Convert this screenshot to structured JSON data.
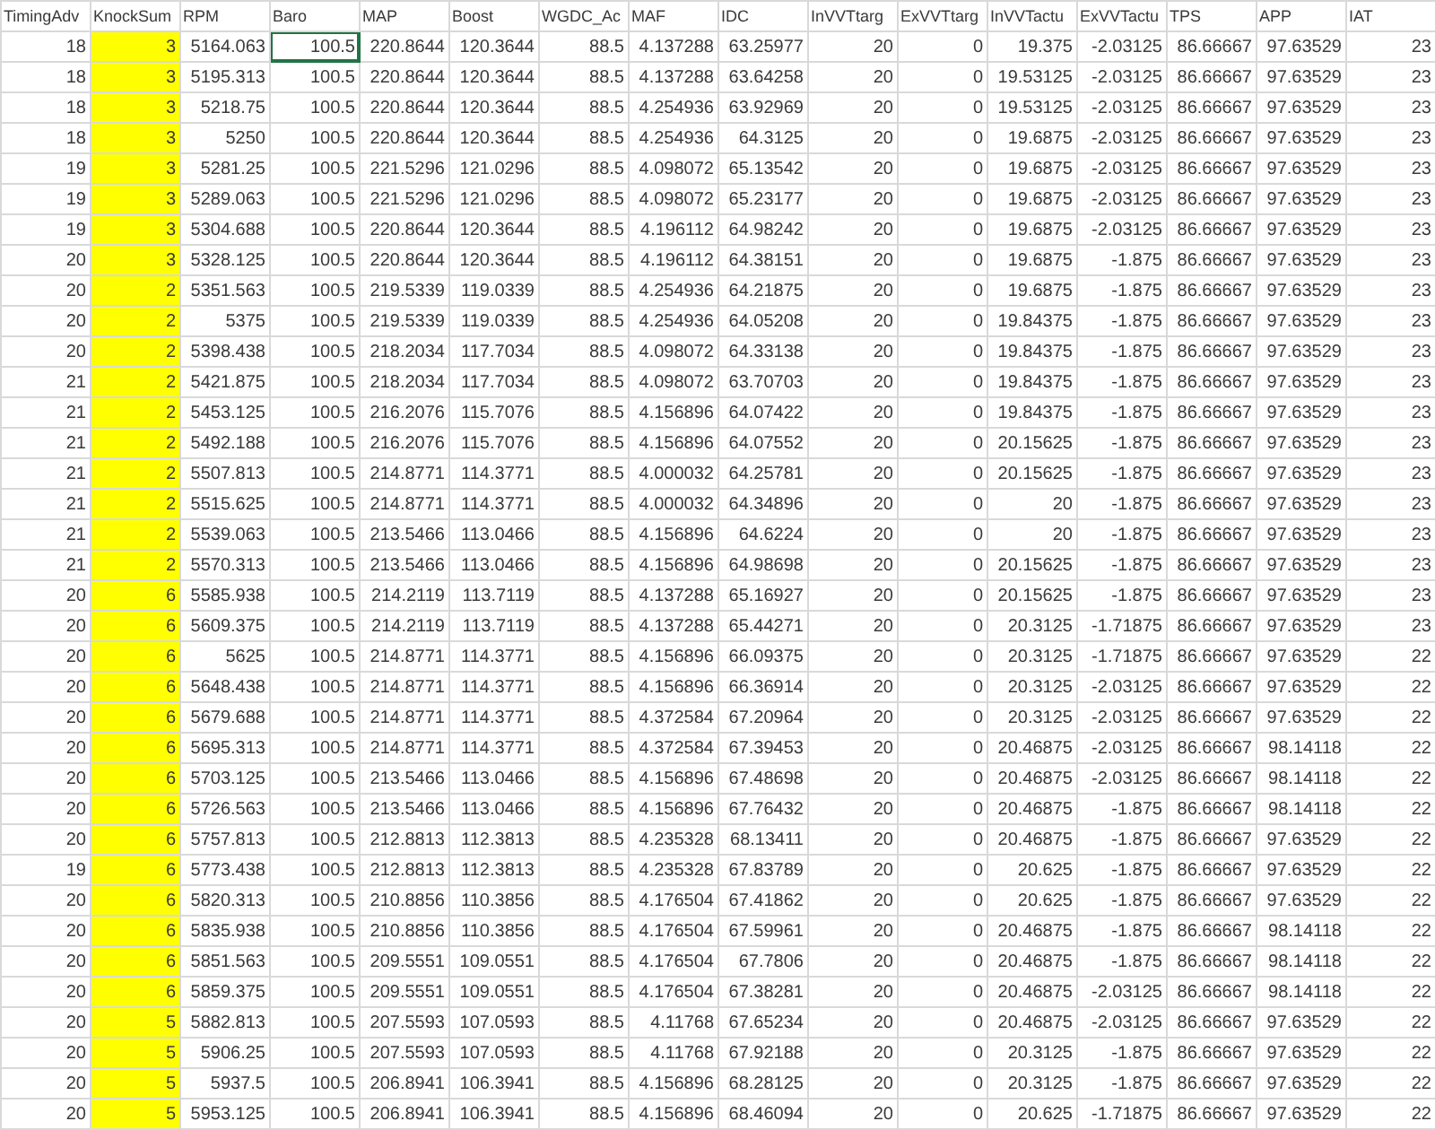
{
  "table": {
    "columns": [
      {
        "label": "TimingAdv",
        "selected": false
      },
      {
        "label": "KnockSum",
        "selected": false,
        "color": "#ffff00"
      },
      {
        "label": "RPM",
        "selected": false
      },
      {
        "label": "Baro",
        "selected": true
      },
      {
        "label": "MAP",
        "selected": false
      },
      {
        "label": "Boost",
        "selected": false
      },
      {
        "label": "WGDC_Ac",
        "selected": false
      },
      {
        "label": "MAF",
        "selected": false
      },
      {
        "label": "IDC",
        "selected": false
      },
      {
        "label": "InVVTtarg",
        "selected": false
      },
      {
        "label": "ExVVTtarg",
        "selected": false
      },
      {
        "label": "InVVTactu",
        "selected": false
      },
      {
        "label": "ExVVTactu",
        "selected": false
      },
      {
        "label": "TPS",
        "selected": false
      },
      {
        "label": "APP",
        "selected": false
      },
      {
        "label": "IAT",
        "selected": false
      }
    ],
    "rows": [
      {
        "selected": true,
        "cells": [
          "18",
          "3",
          "5164.063",
          "100.5",
          "220.8644",
          "120.3644",
          "88.5",
          "4.137288",
          "63.25977",
          "20",
          "0",
          "19.375",
          "-2.03125",
          "86.66667",
          "97.63529",
          "23"
        ]
      },
      {
        "selected": false,
        "cells": [
          "18",
          "3",
          "5195.313",
          "100.5",
          "220.8644",
          "120.3644",
          "88.5",
          "4.137288",
          "63.64258",
          "20",
          "0",
          "19.53125",
          "-2.03125",
          "86.66667",
          "97.63529",
          "23"
        ]
      },
      {
        "selected": false,
        "cells": [
          "18",
          "3",
          "5218.75",
          "100.5",
          "220.8644",
          "120.3644",
          "88.5",
          "4.254936",
          "63.92969",
          "20",
          "0",
          "19.53125",
          "-2.03125",
          "86.66667",
          "97.63529",
          "23"
        ]
      },
      {
        "selected": false,
        "cells": [
          "18",
          "3",
          "5250",
          "100.5",
          "220.8644",
          "120.3644",
          "88.5",
          "4.254936",
          "64.3125",
          "20",
          "0",
          "19.6875",
          "-2.03125",
          "86.66667",
          "97.63529",
          "23"
        ]
      },
      {
        "selected": false,
        "cells": [
          "19",
          "3",
          "5281.25",
          "100.5",
          "221.5296",
          "121.0296",
          "88.5",
          "4.098072",
          "65.13542",
          "20",
          "0",
          "19.6875",
          "-2.03125",
          "86.66667",
          "97.63529",
          "23"
        ]
      },
      {
        "selected": false,
        "cells": [
          "19",
          "3",
          "5289.063",
          "100.5",
          "221.5296",
          "121.0296",
          "88.5",
          "4.098072",
          "65.23177",
          "20",
          "0",
          "19.6875",
          "-2.03125",
          "86.66667",
          "97.63529",
          "23"
        ]
      },
      {
        "selected": false,
        "cells": [
          "19",
          "3",
          "5304.688",
          "100.5",
          "220.8644",
          "120.3644",
          "88.5",
          "4.196112",
          "64.98242",
          "20",
          "0",
          "19.6875",
          "-2.03125",
          "86.66667",
          "97.63529",
          "23"
        ]
      },
      {
        "selected": false,
        "cells": [
          "20",
          "3",
          "5328.125",
          "100.5",
          "220.8644",
          "120.3644",
          "88.5",
          "4.196112",
          "64.38151",
          "20",
          "0",
          "19.6875",
          "-1.875",
          "86.66667",
          "97.63529",
          "23"
        ]
      },
      {
        "selected": false,
        "cells": [
          "20",
          "2",
          "5351.563",
          "100.5",
          "219.5339",
          "119.0339",
          "88.5",
          "4.254936",
          "64.21875",
          "20",
          "0",
          "19.6875",
          "-1.875",
          "86.66667",
          "97.63529",
          "23"
        ]
      },
      {
        "selected": false,
        "cells": [
          "20",
          "2",
          "5375",
          "100.5",
          "219.5339",
          "119.0339",
          "88.5",
          "4.254936",
          "64.05208",
          "20",
          "0",
          "19.84375",
          "-1.875",
          "86.66667",
          "97.63529",
          "23"
        ]
      },
      {
        "selected": false,
        "cells": [
          "20",
          "2",
          "5398.438",
          "100.5",
          "218.2034",
          "117.7034",
          "88.5",
          "4.098072",
          "64.33138",
          "20",
          "0",
          "19.84375",
          "-1.875",
          "86.66667",
          "97.63529",
          "23"
        ]
      },
      {
        "selected": false,
        "cells": [
          "21",
          "2",
          "5421.875",
          "100.5",
          "218.2034",
          "117.7034",
          "88.5",
          "4.098072",
          "63.70703",
          "20",
          "0",
          "19.84375",
          "-1.875",
          "86.66667",
          "97.63529",
          "23"
        ]
      },
      {
        "selected": false,
        "cells": [
          "21",
          "2",
          "5453.125",
          "100.5",
          "216.2076",
          "115.7076",
          "88.5",
          "4.156896",
          "64.07422",
          "20",
          "0",
          "19.84375",
          "-1.875",
          "86.66667",
          "97.63529",
          "23"
        ]
      },
      {
        "selected": false,
        "cells": [
          "21",
          "2",
          "5492.188",
          "100.5",
          "216.2076",
          "115.7076",
          "88.5",
          "4.156896",
          "64.07552",
          "20",
          "0",
          "20.15625",
          "-1.875",
          "86.66667",
          "97.63529",
          "23"
        ]
      },
      {
        "selected": false,
        "cells": [
          "21",
          "2",
          "5507.813",
          "100.5",
          "214.8771",
          "114.3771",
          "88.5",
          "4.000032",
          "64.25781",
          "20",
          "0",
          "20.15625",
          "-1.875",
          "86.66667",
          "97.63529",
          "23"
        ]
      },
      {
        "selected": false,
        "cells": [
          "21",
          "2",
          "5515.625",
          "100.5",
          "214.8771",
          "114.3771",
          "88.5",
          "4.000032",
          "64.34896",
          "20",
          "0",
          "20",
          "-1.875",
          "86.66667",
          "97.63529",
          "23"
        ]
      },
      {
        "selected": false,
        "cells": [
          "21",
          "2",
          "5539.063",
          "100.5",
          "213.5466",
          "113.0466",
          "88.5",
          "4.156896",
          "64.6224",
          "20",
          "0",
          "20",
          "-1.875",
          "86.66667",
          "97.63529",
          "23"
        ]
      },
      {
        "selected": false,
        "cells": [
          "21",
          "2",
          "5570.313",
          "100.5",
          "213.5466",
          "113.0466",
          "88.5",
          "4.156896",
          "64.98698",
          "20",
          "0",
          "20.15625",
          "-1.875",
          "86.66667",
          "97.63529",
          "23"
        ]
      },
      {
        "selected": false,
        "cells": [
          "20",
          "6",
          "5585.938",
          "100.5",
          "214.2119",
          "113.7119",
          "88.5",
          "4.137288",
          "65.16927",
          "20",
          "0",
          "20.15625",
          "-1.875",
          "86.66667",
          "97.63529",
          "23"
        ]
      },
      {
        "selected": false,
        "cells": [
          "20",
          "6",
          "5609.375",
          "100.5",
          "214.2119",
          "113.7119",
          "88.5",
          "4.137288",
          "65.44271",
          "20",
          "0",
          "20.3125",
          "-1.71875",
          "86.66667",
          "97.63529",
          "23"
        ]
      },
      {
        "selected": false,
        "cells": [
          "20",
          "6",
          "5625",
          "100.5",
          "214.8771",
          "114.3771",
          "88.5",
          "4.156896",
          "66.09375",
          "20",
          "0",
          "20.3125",
          "-1.71875",
          "86.66667",
          "97.63529",
          "22"
        ]
      },
      {
        "selected": false,
        "cells": [
          "20",
          "6",
          "5648.438",
          "100.5",
          "214.8771",
          "114.3771",
          "88.5",
          "4.156896",
          "66.36914",
          "20",
          "0",
          "20.3125",
          "-2.03125",
          "86.66667",
          "97.63529",
          "22"
        ]
      },
      {
        "selected": false,
        "cells": [
          "20",
          "6",
          "5679.688",
          "100.5",
          "214.8771",
          "114.3771",
          "88.5",
          "4.372584",
          "67.20964",
          "20",
          "0",
          "20.3125",
          "-2.03125",
          "86.66667",
          "97.63529",
          "22"
        ]
      },
      {
        "selected": false,
        "cells": [
          "20",
          "6",
          "5695.313",
          "100.5",
          "214.8771",
          "114.3771",
          "88.5",
          "4.372584",
          "67.39453",
          "20",
          "0",
          "20.46875",
          "-2.03125",
          "86.66667",
          "98.14118",
          "22"
        ]
      },
      {
        "selected": false,
        "cells": [
          "20",
          "6",
          "5703.125",
          "100.5",
          "213.5466",
          "113.0466",
          "88.5",
          "4.156896",
          "67.48698",
          "20",
          "0",
          "20.46875",
          "-2.03125",
          "86.66667",
          "98.14118",
          "22"
        ]
      },
      {
        "selected": false,
        "cells": [
          "20",
          "6",
          "5726.563",
          "100.5",
          "213.5466",
          "113.0466",
          "88.5",
          "4.156896",
          "67.76432",
          "20",
          "0",
          "20.46875",
          "-1.875",
          "86.66667",
          "98.14118",
          "22"
        ]
      },
      {
        "selected": false,
        "cells": [
          "20",
          "6",
          "5757.813",
          "100.5",
          "212.8813",
          "112.3813",
          "88.5",
          "4.235328",
          "68.13411",
          "20",
          "0",
          "20.46875",
          "-1.875",
          "86.66667",
          "97.63529",
          "22"
        ]
      },
      {
        "selected": false,
        "cells": [
          "19",
          "6",
          "5773.438",
          "100.5",
          "212.8813",
          "112.3813",
          "88.5",
          "4.235328",
          "67.83789",
          "20",
          "0",
          "20.625",
          "-1.875",
          "86.66667",
          "97.63529",
          "22"
        ]
      },
      {
        "selected": false,
        "cells": [
          "20",
          "6",
          "5820.313",
          "100.5",
          "210.8856",
          "110.3856",
          "88.5",
          "4.176504",
          "67.41862",
          "20",
          "0",
          "20.625",
          "-1.875",
          "86.66667",
          "97.63529",
          "22"
        ]
      },
      {
        "selected": false,
        "cells": [
          "20",
          "6",
          "5835.938",
          "100.5",
          "210.8856",
          "110.3856",
          "88.5",
          "4.176504",
          "67.59961",
          "20",
          "0",
          "20.46875",
          "-1.875",
          "86.66667",
          "98.14118",
          "22"
        ]
      },
      {
        "selected": false,
        "cells": [
          "20",
          "6",
          "5851.563",
          "100.5",
          "209.5551",
          "109.0551",
          "88.5",
          "4.176504",
          "67.7806",
          "20",
          "0",
          "20.46875",
          "-1.875",
          "86.66667",
          "98.14118",
          "22"
        ]
      },
      {
        "selected": false,
        "cells": [
          "20",
          "6",
          "5859.375",
          "100.5",
          "209.5551",
          "109.0551",
          "88.5",
          "4.176504",
          "67.38281",
          "20",
          "0",
          "20.46875",
          "-2.03125",
          "86.66667",
          "98.14118",
          "22"
        ]
      },
      {
        "selected": false,
        "cells": [
          "20",
          "5",
          "5882.813",
          "100.5",
          "207.5593",
          "107.0593",
          "88.5",
          "4.11768",
          "67.65234",
          "20",
          "0",
          "20.46875",
          "-2.03125",
          "86.66667",
          "97.63529",
          "22"
        ]
      },
      {
        "selected": false,
        "cells": [
          "20",
          "5",
          "5906.25",
          "100.5",
          "207.5593",
          "107.0593",
          "88.5",
          "4.11768",
          "67.92188",
          "20",
          "0",
          "20.3125",
          "-1.875",
          "86.66667",
          "97.63529",
          "22"
        ]
      },
      {
        "selected": false,
        "cells": [
          "20",
          "5",
          "5937.5",
          "100.5",
          "206.8941",
          "106.3941",
          "88.5",
          "4.156896",
          "68.28125",
          "20",
          "0",
          "20.3125",
          "-1.875",
          "86.66667",
          "97.63529",
          "22"
        ]
      },
      {
        "selected": false,
        "cells": [
          "20",
          "5",
          "5953.125",
          "100.5",
          "206.8941",
          "106.3941",
          "88.5",
          "4.156896",
          "68.46094",
          "20",
          "0",
          "20.625",
          "-1.71875",
          "86.66667",
          "97.63529",
          "22"
        ]
      }
    ]
  }
}
